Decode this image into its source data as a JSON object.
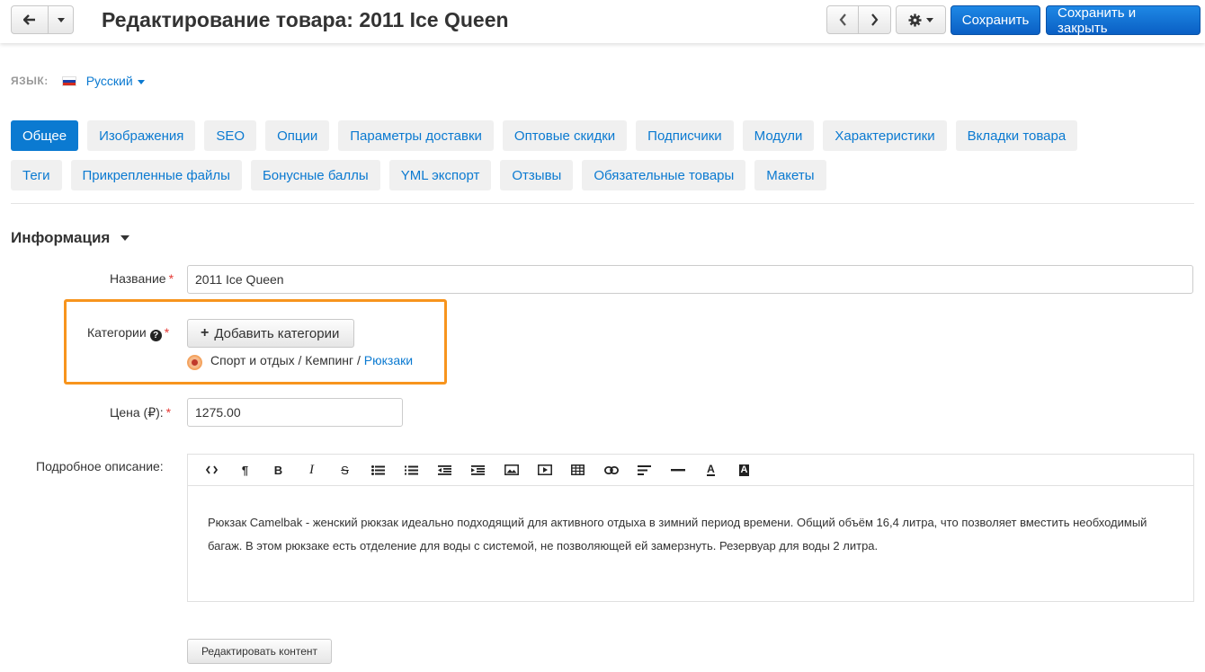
{
  "header": {
    "title": "Редактирование товара: 2011 Ice Queen",
    "save_label": "Сохранить",
    "save_close_label": "Сохранить и закрыть"
  },
  "language": {
    "label": "ЯЗЫК:",
    "value": "Русский"
  },
  "tabs": [
    {
      "label": "Общее",
      "active": true
    },
    {
      "label": "Изображения"
    },
    {
      "label": "SEO"
    },
    {
      "label": "Опции"
    },
    {
      "label": "Параметры доставки"
    },
    {
      "label": "Оптовые скидки"
    },
    {
      "label": "Подписчики"
    },
    {
      "label": "Модули"
    },
    {
      "label": "Характеристики"
    },
    {
      "label": "Вкладки товара"
    },
    {
      "label": "Теги"
    },
    {
      "label": "Прикрепленные файлы"
    },
    {
      "label": "Бонусные баллы"
    },
    {
      "label": "YML экспорт"
    },
    {
      "label": "Отзывы"
    },
    {
      "label": "Обязательные товары"
    },
    {
      "label": "Макеты"
    }
  ],
  "section": {
    "title": "Информация"
  },
  "form": {
    "name_label": "Название",
    "name_value": "2011 Ice Queen",
    "categories_label": "Категории",
    "add_categories_label": "Добавить категории",
    "category_path_prefix": "Спорт и отдых / Кемпинг / ",
    "category_path_link": "Рюкзаки",
    "price_label": "Цена (₽):",
    "price_value": "1275.00",
    "description_label": "Подробное описание:",
    "description_text": "Рюкзак Camelbak - женский рюкзак идеально подходящий для активного отдыха в зимний период времени. Общий объём 16,4 литра, что позволяет вместить необходимый багаж. В этом рюкзаке есть отделение для воды с системой, не позволяющей ей замерзнуть. Резервуар для воды 2 литра.",
    "edit_content_label": "Редактировать контент"
  },
  "colors": {
    "primary": "#0b7ad1",
    "highlight": "#f7941d",
    "required": "#e53935"
  }
}
